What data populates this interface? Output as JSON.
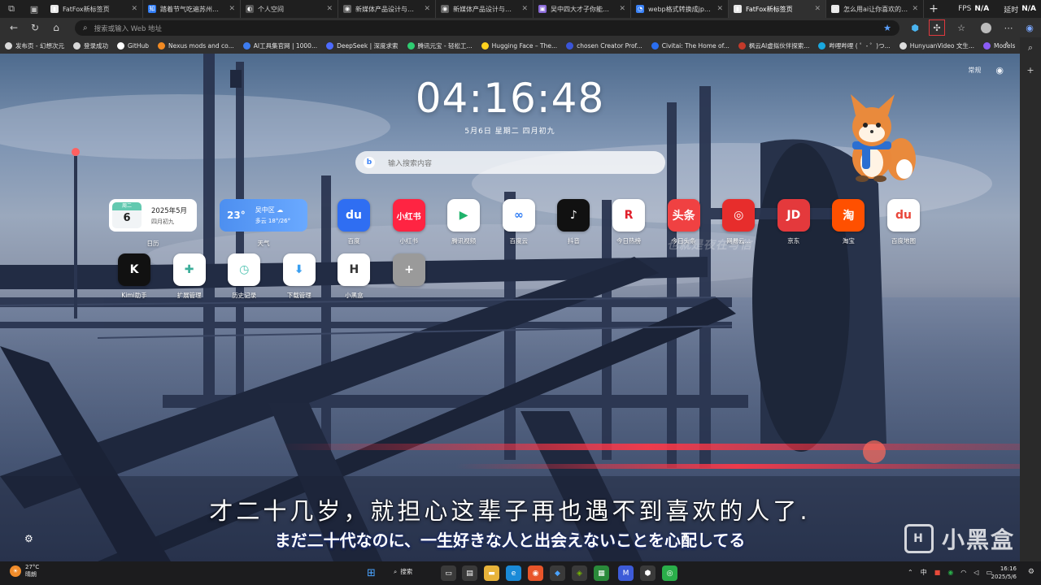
{
  "tabs": [
    {
      "title": "FatFox新标签页",
      "fav": "#e8e8e8",
      "fav_glyph": "▮"
    },
    {
      "title": "踏着节气吃遍苏州时令菜",
      "fav": "#2f7cf6",
      "fav_glyph": "知"
    },
    {
      "title": "个人空间",
      "fav": "#555",
      "fav_glyph": "◐"
    },
    {
      "title": "新媒体产品设计与制作",
      "fav": "#666",
      "fav_glyph": "◉"
    },
    {
      "title": "新媒体产品设计与制作",
      "fav": "#666",
      "fav_glyph": "◉"
    },
    {
      "title": "吴中四大才子你能一口气",
      "fav": "#8a6ad8",
      "fav_glyph": "▣"
    },
    {
      "title": "webp格式转换成jpg - 搜",
      "fav": "#3a82f7",
      "fav_glyph": "◔"
    },
    {
      "title": "FatFox新标签页",
      "fav": "#e8e8e8",
      "fav_glyph": "▮"
    },
    {
      "title": "怎么用ai让你喜欢的角色",
      "fav": "#e8e8e8",
      "fav_glyph": "◻"
    }
  ],
  "perf": {
    "fps_label": "FPS",
    "fps_value": "N/A",
    "delay_label": "延时",
    "delay_value": "N/A"
  },
  "address": {
    "placeholder": "搜索或输入 Web 地址"
  },
  "bookmarks": [
    {
      "label": "发布页 - 幻想次元",
      "color": "#d8d8d8"
    },
    {
      "label": "登录成功",
      "color": "#d8d8d8"
    },
    {
      "label": "GitHub",
      "color": "#ffffff"
    },
    {
      "label": "Nexus mods and co...",
      "color": "#f28a22"
    },
    {
      "label": "AI工具集官网 | 1000...",
      "color": "#3d7cf0"
    },
    {
      "label": "DeepSeek | 深度求索",
      "color": "#4d6bfe"
    },
    {
      "label": "腾讯元宝 - 轻松工...",
      "color": "#2ecc71"
    },
    {
      "label": "Hugging Face – The...",
      "color": "#ffd21e"
    },
    {
      "label": "chosen Creator Prof...",
      "color": "#3a55d8"
    },
    {
      "label": "Civitai: The Home of...",
      "color": "#2a6ef0"
    },
    {
      "label": "枫云AI虚拟伙伴探索...",
      "color": "#c43a2a"
    },
    {
      "label": "哔哩哔哩 ( ゜- ゜)つ...",
      "color": "#19a8e0"
    },
    {
      "label": "HunyuanVideo 文生...",
      "color": "#dddddd"
    },
    {
      "label": "Models",
      "color": "#8b5cf6"
    }
  ],
  "ntp": {
    "mode_label": "常规",
    "clock": "04:16:48",
    "date": "5月6日  星期二  四月初九",
    "search_placeholder": "输入搜索内容",
    "calendar": {
      "weekday": "周二",
      "day": "6",
      "year_month": "2025年5月",
      "lunar": "四月初九",
      "label": "日历"
    },
    "weather": {
      "temp": "23°",
      "city": "吴中区 ☁",
      "cond": "多云 18°/26°",
      "label": "天气"
    },
    "tiles_row1": [
      {
        "label": "百度",
        "glyph": "du",
        "bg": "#2f6ef2",
        "fg": "#ffffff"
      },
      {
        "label": "小红书",
        "glyph": "小红书",
        "bg": "#ff2442",
        "fg": "#ffffff"
      },
      {
        "label": "腾讯视频",
        "glyph": "▶",
        "bg": "#ffffff",
        "fg": "#1fb36b"
      },
      {
        "label": "百度云",
        "glyph": "∞",
        "bg": "#ffffff",
        "fg": "#2d7bf4"
      },
      {
        "label": "抖音",
        "glyph": "♪",
        "bg": "#111111",
        "fg": "#ffffff"
      },
      {
        "label": "今日热榜",
        "glyph": "R",
        "bg": "#ffffff",
        "fg": "#e0202c"
      },
      {
        "label": "今日头条",
        "glyph": "头条",
        "bg": "#f04142",
        "fg": "#ffffff"
      },
      {
        "label": "网易云…",
        "glyph": "◎",
        "bg": "#e72d2c",
        "fg": "#ffffff"
      },
      {
        "label": "京东",
        "glyph": "JD",
        "bg": "#e4393c",
        "fg": "#ffffff"
      },
      {
        "label": "淘宝",
        "glyph": "淘",
        "bg": "#ff5000",
        "fg": "#ffffff"
      },
      {
        "label": "百度地图",
        "glyph": "du",
        "bg": "#ffffff",
        "fg": "#e9473b"
      }
    ],
    "tiles_row2": [
      {
        "label": "Kimi助手",
        "glyph": "K",
        "bg": "#111111",
        "fg": "#ffffff"
      },
      {
        "label": "扩展管理",
        "glyph": "✚",
        "bg": "#ffffff",
        "fg": "#3cae9a"
      },
      {
        "label": "历史记录",
        "glyph": "◷",
        "bg": "#ffffff",
        "fg": "#4bc2b0"
      },
      {
        "label": "下载管理",
        "glyph": "⬇",
        "bg": "#ffffff",
        "fg": "#3a9ff0"
      },
      {
        "label": "小黑盒",
        "glyph": "H",
        "bg": "#ffffff",
        "fg": "#333333"
      },
      {
        "label": "",
        "glyph": "+",
        "bg": "#9a9a9a",
        "fg": "#ffffff"
      }
    ],
    "watermark": "也就是夜在写信",
    "subtitle_cn": "才二十几岁，就担心这辈子再也遇不到喜欢的人了.",
    "subtitle_jp": "まだ二十代なのに、一生好きな人と出会えないことを心配してる",
    "brand": "小黑盒"
  },
  "taskbar": {
    "weather_temp": "27°C",
    "weather_cond": "晴朗",
    "search_label": "搜索",
    "ime": "中",
    "time": "16:16",
    "date": "2025/5/6"
  }
}
